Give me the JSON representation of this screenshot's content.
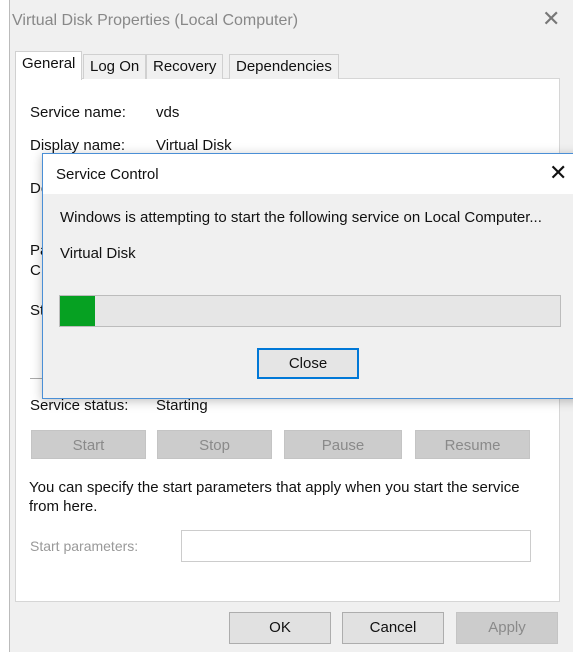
{
  "window": {
    "title": "Virtual Disk Properties (Local Computer)",
    "close_icon": "close-icon"
  },
  "tabs": [
    {
      "label": "General",
      "active": true
    },
    {
      "label": "Log On"
    },
    {
      "label": "Recovery"
    },
    {
      "label": "Dependencies"
    }
  ],
  "general": {
    "service_name_label": "Service name:",
    "service_name": "vds",
    "display_name_label": "Display name:",
    "display_name": "Virtual Disk",
    "partial_labels": [
      "De",
      "Pa",
      "C:",
      "St"
    ],
    "service_status_label": "Service status:",
    "service_status": "Starting",
    "buttons": {
      "start": "Start",
      "stop": "Stop",
      "pause": "Pause",
      "resume": "Resume"
    },
    "hint": "You can specify the start parameters that apply when you start the service from here.",
    "start_params_label": "Start parameters:",
    "start_params_value": ""
  },
  "footer": {
    "ok": "OK",
    "cancel": "Cancel",
    "apply": "Apply"
  },
  "dialog": {
    "title": "Service Control",
    "message": "Windows is attempting to start the following service on Local Computer...",
    "service": "Virtual Disk",
    "progress_percent": 7,
    "progress_color": "#06a122",
    "close": "Close"
  }
}
